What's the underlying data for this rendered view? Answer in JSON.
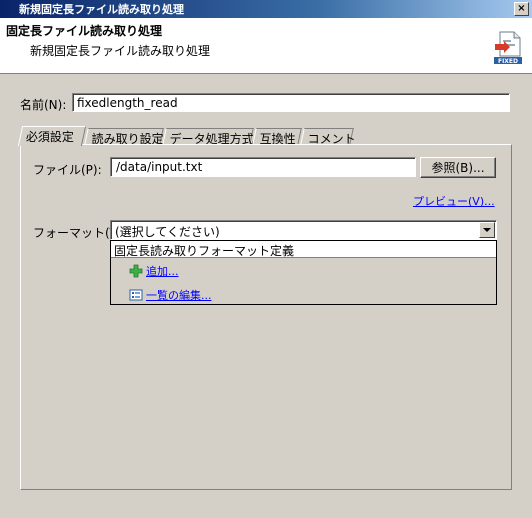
{
  "window": {
    "title": "新規固定長ファイル読み取り処理",
    "close_glyph": "×"
  },
  "header": {
    "title": "固定長ファイル読み取り処理",
    "description": "新規固定長ファイル読み取り処理",
    "icon": "fixed-file-icon",
    "icon_caption": "FIXED"
  },
  "name_field": {
    "label": "名前(N):",
    "value": "fixedlength_read"
  },
  "tabs": [
    {
      "label": "必須設定",
      "active": true
    },
    {
      "label": "読み取り設定",
      "active": false
    },
    {
      "label": "データ処理方式",
      "active": false
    },
    {
      "label": "互換性",
      "active": false
    },
    {
      "label": "コメント",
      "active": false
    }
  ],
  "file_field": {
    "label": "ファイル(P):",
    "value": "/data/input.txt",
    "browse_label": "参照(B)..."
  },
  "preview_link": "プレビュー(V)...",
  "format_field": {
    "label": "フォーマット(T):",
    "selected": "(選択してください)",
    "options": [
      "固定長読み取りフォーマット定義"
    ],
    "actions": [
      {
        "label": "追加...",
        "icon": "add-icon"
      },
      {
        "label": "一覧の編集...",
        "icon": "list-edit-icon"
      }
    ]
  },
  "colors": {
    "title_bar_start": "#0a246a",
    "title_bar_end": "#a6caf0",
    "window_bg": "#d4d0c8",
    "link": "#0000ff",
    "add_icon": "#3cb043"
  }
}
